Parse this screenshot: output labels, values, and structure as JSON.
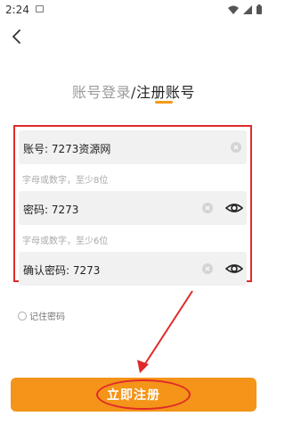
{
  "status_bar": {
    "time": "2:24"
  },
  "tabs": {
    "login_label": "账号登录",
    "separator": "/",
    "register_label": "注册账号"
  },
  "form": {
    "account_label": "账号: 7273资源网",
    "account_hint": "字母或数字，至少8位",
    "password_label": "密码: 7273",
    "password_hint": "字母或数字，至少6位",
    "confirm_label": "确认密码: 7273"
  },
  "remember": {
    "label": "记住密码",
    "checked": false
  },
  "submit": {
    "label": "立即注册"
  },
  "colors": {
    "accent": "#f49418",
    "annotation": "#e02a2a",
    "field_bg": "#f1f1f1",
    "hint_text": "#a9a9a9"
  },
  "icons": [
    "notification-icon",
    "wifi-icon",
    "signal-icon",
    "battery-icon",
    "back-arrow-icon",
    "clear-icon",
    "eye-icon"
  ]
}
